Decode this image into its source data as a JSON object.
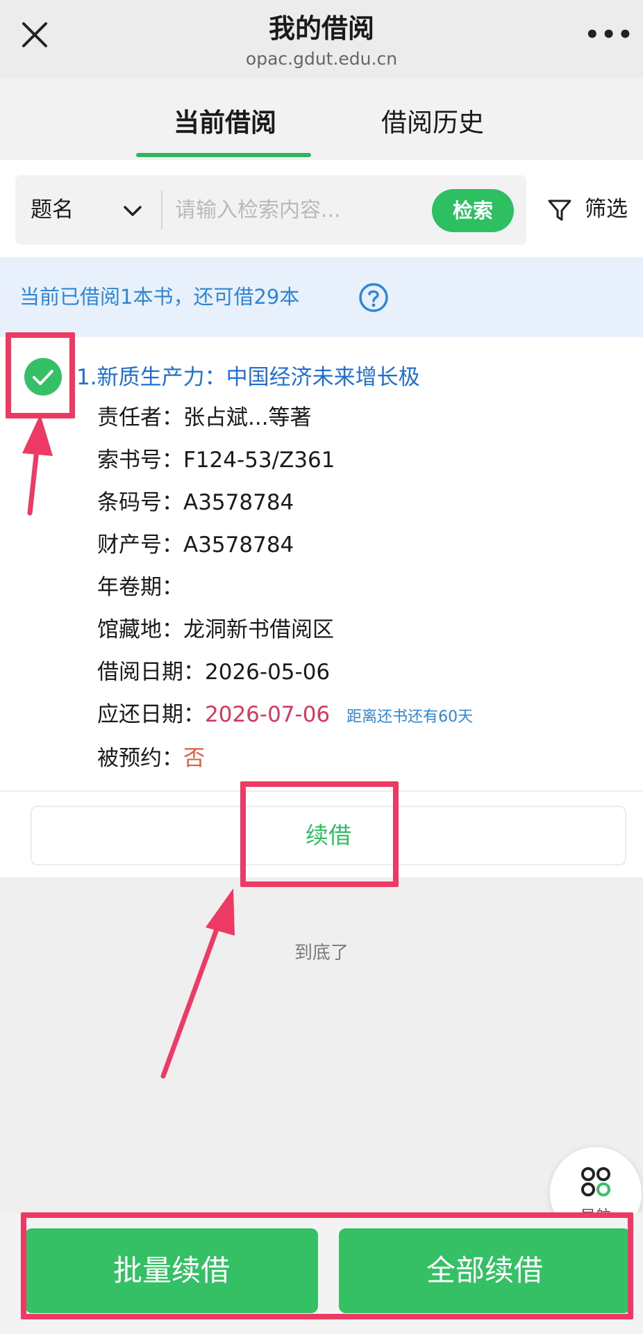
{
  "header": {
    "title": "我的借阅",
    "url": "opac.gdut.edu.cn",
    "more_label": "•••"
  },
  "tabs": [
    {
      "label": "当前借阅",
      "active": true
    },
    {
      "label": "借阅历史",
      "active": false
    }
  ],
  "search": {
    "field": "题名",
    "placeholder": "请输入检索内容...",
    "button_label": "检索",
    "filter_label": "筛选"
  },
  "borrow_summary": "当前已借阅1本书，还可借29本",
  "book": {
    "title": "1.新质生产力：中国经济未来增长极",
    "fields": [
      {
        "label": "责任者：",
        "value": "张占斌...等著"
      },
      {
        "label": "索书号：",
        "value": "F124-53/Z361"
      },
      {
        "label": "条码号：",
        "value": "A3578784"
      },
      {
        "label": "财产号：",
        "value": "A3578784"
      },
      {
        "label": "年卷期：",
        "value": ""
      },
      {
        "label": "馆藏地：",
        "value": "龙洞新书借阅区"
      },
      {
        "label": "借阅日期：",
        "value": "2026-05-06"
      }
    ],
    "due": {
      "label": "应还日期：",
      "value": "2026-07-06",
      "note": "距离还书还有60天"
    },
    "reserved": {
      "label": "被预约：",
      "value": "否"
    },
    "renew_label": "续借"
  },
  "end_text": "到底了",
  "nav_float_label": "导航",
  "bottom_bar": {
    "batch_renew": "批量续借",
    "all_renew": "全部续借"
  },
  "colors": {
    "accent_green": "#2fbf63",
    "link_blue": "#1f6fd1",
    "due_red": "#d8365f",
    "annotation": "#ec3a64"
  }
}
